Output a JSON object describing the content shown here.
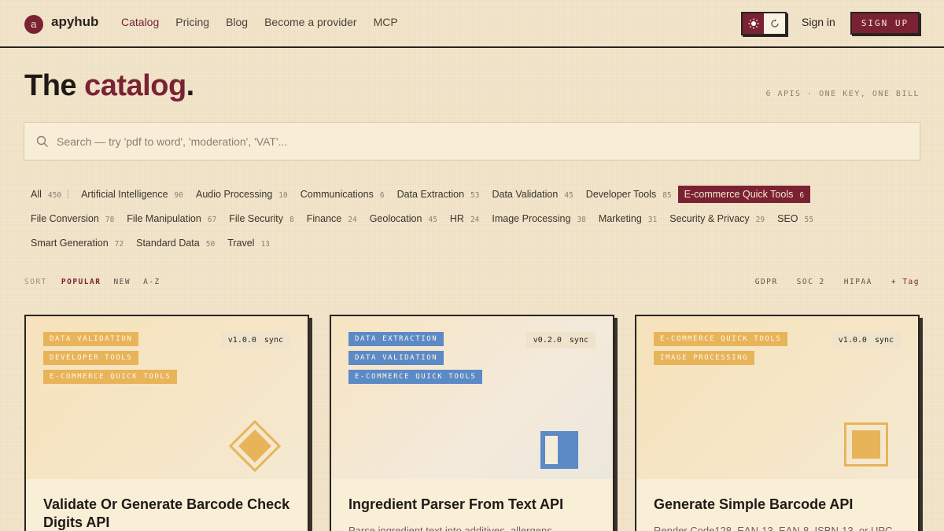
{
  "header": {
    "logo_letter": "a",
    "brand": "apyhub",
    "nav": [
      "Catalog",
      "Pricing",
      "Blog",
      "Become a provider",
      "MCP"
    ],
    "sign_in": "Sign in",
    "sign_up": "SIGN UP"
  },
  "page": {
    "title_prefix": "The ",
    "title_accent": "catalog",
    "title_suffix": ".",
    "api_count": "6 APIS · ONE KEY, ONE BILL"
  },
  "search": {
    "placeholder": "Search — try 'pdf to word', 'moderation', 'VAT'..."
  },
  "categories": [
    [
      {
        "label": "All",
        "count": "450"
      },
      {
        "label": "Artificial Intelligence",
        "count": "90"
      },
      {
        "label": "Audio Processing",
        "count": "10"
      },
      {
        "label": "Communications",
        "count": "6"
      },
      {
        "label": "Data Extraction",
        "count": "53"
      },
      {
        "label": "Data Validation",
        "count": "45"
      },
      {
        "label": "Developer Tools",
        "count": "85"
      },
      {
        "label": "E-commerce Quick Tools",
        "count": "6",
        "active": true
      }
    ],
    [
      {
        "label": "File Conversion",
        "count": "78"
      },
      {
        "label": "File Manipulation",
        "count": "67"
      },
      {
        "label": "File Security",
        "count": "8"
      },
      {
        "label": "Finance",
        "count": "24"
      },
      {
        "label": "Geolocation",
        "count": "45"
      },
      {
        "label": "HR",
        "count": "24"
      },
      {
        "label": "Image Processing",
        "count": "38"
      },
      {
        "label": "Marketing",
        "count": "31"
      },
      {
        "label": "Security & Privacy",
        "count": "29"
      },
      {
        "label": "SEO",
        "count": "55"
      }
    ],
    [
      {
        "label": "Smart Generation",
        "count": "72"
      },
      {
        "label": "Standard Data",
        "count": "50"
      },
      {
        "label": "Travel",
        "count": "13"
      }
    ]
  ],
  "sort": {
    "label": "SORT",
    "options": [
      "POPULAR",
      "NEW",
      "A-Z"
    ],
    "active": "POPULAR",
    "tag_filters": [
      "GDPR",
      "SOC 2",
      "HIPAA"
    ],
    "add_tag": "+ Tag"
  },
  "cards": [
    {
      "tags": [
        "DATA VALIDATION",
        "DEVELOPER TOOLS",
        "E-COMMERCE QUICK TOOLS"
      ],
      "tag_color": "#e8b45a",
      "version": "v1.0.0",
      "mode": "sync",
      "icon": "diamond-icon",
      "title": "Validate Or Generate Barcode Check Digits API",
      "description": ""
    },
    {
      "tags": [
        "DATA EXTRACTION",
        "DATA VALIDATION",
        "E-COMMERCE QUICK TOOLS"
      ],
      "tag_color": "#5b8ac6",
      "version": "v0.2.0",
      "mode": "sync",
      "icon": "split-rect-icon",
      "title": "Ingredient Parser From Text API",
      "description": "Parse ingredient text into additives, allergens"
    },
    {
      "tags": [
        "E-COMMERCE QUICK TOOLS",
        "IMAGE PROCESSING"
      ],
      "tag_color": "#e8b45a",
      "version": "v1.0.0",
      "mode": "sync",
      "icon": "square-in-square-icon",
      "title": "Generate Simple Barcode API",
      "description": "Render Code128, EAN-13, EAN-8, ISBN-13, or UPC-"
    }
  ],
  "colors": {
    "accent": "#7a2233",
    "background": "#f3e6cc",
    "tag_orange": "#e8b45a",
    "tag_blue": "#5b8ac6"
  }
}
